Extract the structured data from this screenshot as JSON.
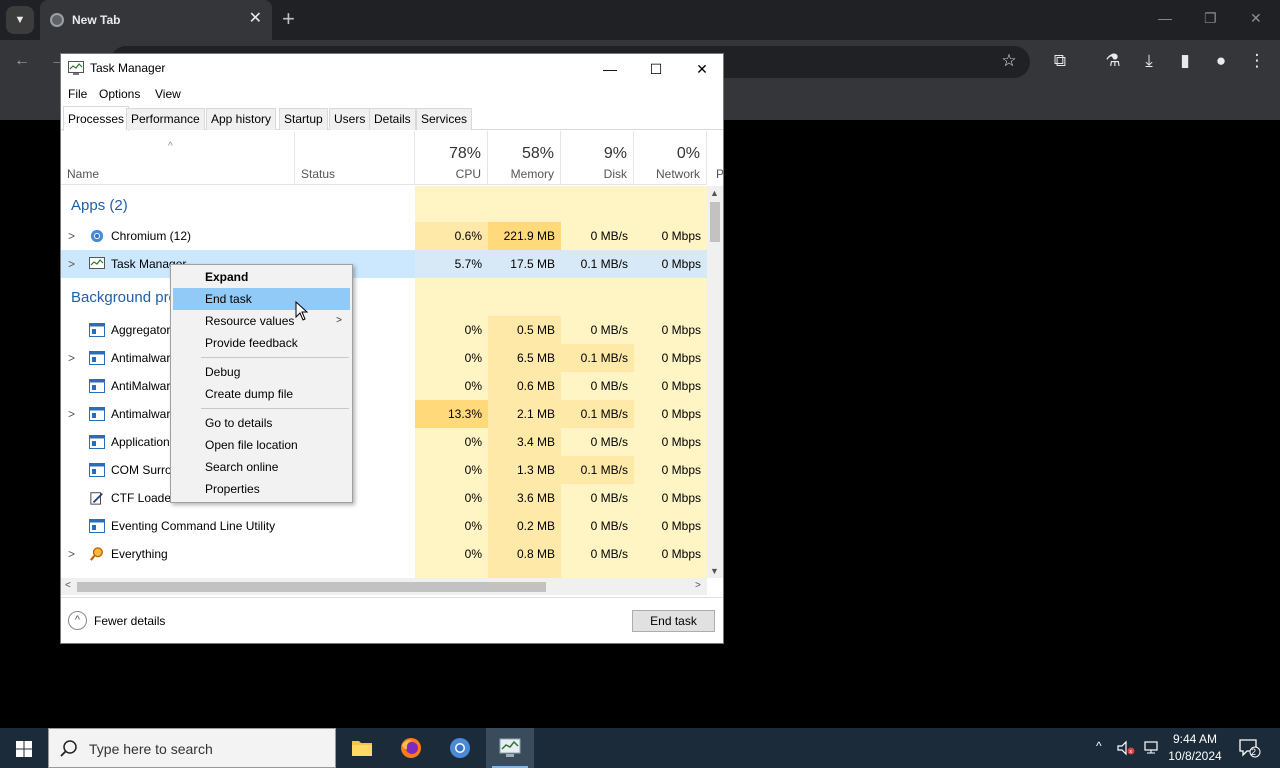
{
  "browser": {
    "tab_title": "New Tab",
    "tab_close": "✕",
    "new_tab": "+"
  },
  "taskmgr": {
    "title": "Task Manager",
    "menus": [
      "File",
      "Options",
      "View"
    ],
    "tabs": [
      "Processes",
      "Performance",
      "App history",
      "Startup",
      "Users",
      "Details",
      "Services"
    ],
    "columns": {
      "name": "Name",
      "status": "Status",
      "cpu": {
        "pct": "78%",
        "label": "CPU"
      },
      "memory": {
        "pct": "58%",
        "label": "Memory"
      },
      "disk": {
        "pct": "9%",
        "label": "Disk"
      },
      "network": {
        "pct": "0%",
        "label": "Network"
      },
      "extra": "P"
    },
    "groups": {
      "apps": "Apps (2)",
      "background": "Background processes (40)"
    },
    "rows": [
      {
        "name": "Chromium (12)",
        "cpu": "0.6%",
        "mem": "221.9 MB",
        "disk": "0 MB/s",
        "net": "0 Mbps"
      },
      {
        "name": "Task Manager",
        "cpu": "5.7%",
        "mem": "17.5 MB",
        "disk": "0.1 MB/s",
        "net": "0 Mbps"
      },
      {
        "name": "Aggregator host",
        "cpu": "0%",
        "mem": "0.5 MB",
        "disk": "0 MB/s",
        "net": "0 Mbps"
      },
      {
        "name": "Antimalware Core Service",
        "cpu": "0%",
        "mem": "6.5 MB",
        "disk": "0.1 MB/s",
        "net": "0 Mbps"
      },
      {
        "name": "AntiMalware Service Executable",
        "cpu": "0%",
        "mem": "0.6 MB",
        "disk": "0 MB/s",
        "net": "0 Mbps"
      },
      {
        "name": "Antimalware Service Executable",
        "cpu": "13.3%",
        "mem": "2.1 MB",
        "disk": "0.1 MB/s",
        "net": "0 Mbps"
      },
      {
        "name": "Application Frame Host",
        "cpu": "0%",
        "mem": "3.4 MB",
        "disk": "0 MB/s",
        "net": "0 Mbps"
      },
      {
        "name": "COM Surrogate",
        "cpu": "0%",
        "mem": "1.3 MB",
        "disk": "0.1 MB/s",
        "net": "0 Mbps"
      },
      {
        "name": "CTF Loader",
        "cpu": "0%",
        "mem": "3.6 MB",
        "disk": "0 MB/s",
        "net": "0 Mbps"
      },
      {
        "name": "Eventing Command Line Utility",
        "cpu": "0%",
        "mem": "0.2 MB",
        "disk": "0 MB/s",
        "net": "0 Mbps"
      },
      {
        "name": "Everything",
        "cpu": "0%",
        "mem": "0.8 MB",
        "disk": "0 MB/s",
        "net": "0 Mbps"
      }
    ],
    "footer": {
      "fewer_details": "Fewer details",
      "end_task": "End task"
    }
  },
  "context_menu": {
    "items": [
      "Expand",
      "End task",
      "Resource values",
      "Provide feedback",
      "Debug",
      "Create dump file",
      "Go to details",
      "Open file location",
      "Search online",
      "Properties"
    ]
  },
  "taskbar": {
    "search_placeholder": "Type here to search",
    "time": "9:44 AM",
    "date": "10/8/2024",
    "notification_count": "2"
  }
}
